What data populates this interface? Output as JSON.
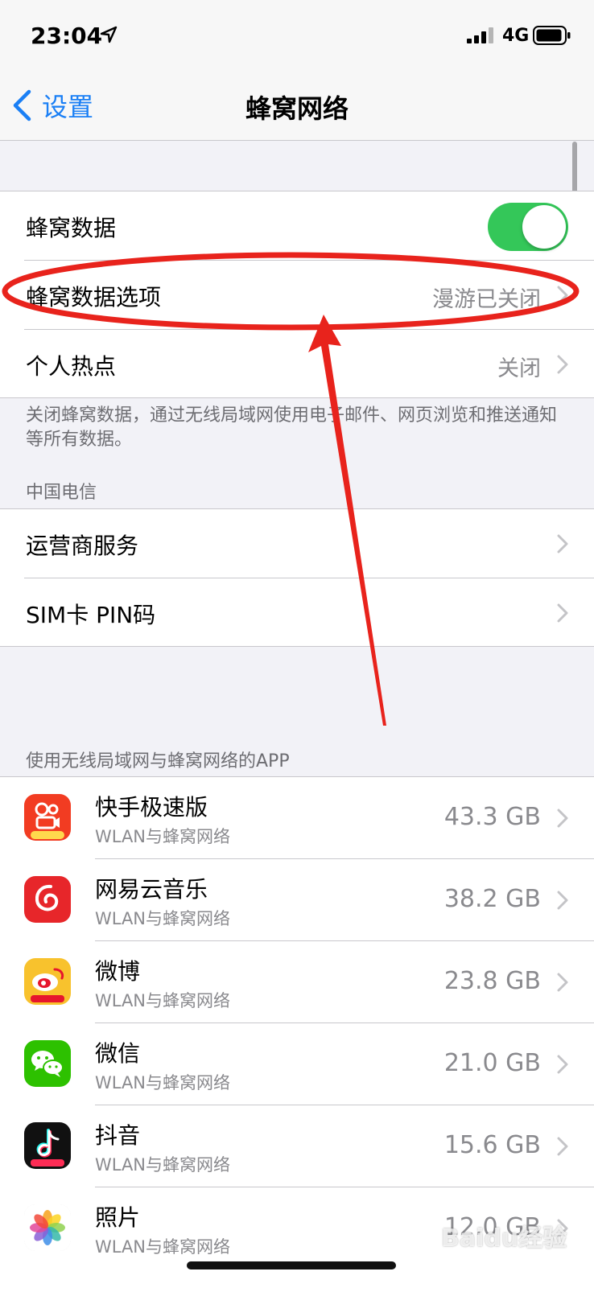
{
  "status_bar": {
    "time": "23:04",
    "network": "4G"
  },
  "nav": {
    "back_label": "设置",
    "title": "蜂窝网络"
  },
  "group1": {
    "cellular_data": {
      "label": "蜂窝数据",
      "enabled": true
    },
    "cellular_options": {
      "label": "蜂窝数据选项",
      "value": "漫游已关闭"
    },
    "hotspot": {
      "label": "个人热点",
      "value": "关闭"
    }
  },
  "footer_note": "关闭蜂窝数据，通过无线局域网使用电子邮件、网页浏览和推送通知等所有数据。",
  "carrier": {
    "header": "中国电信",
    "items": [
      {
        "label": "运营商服务"
      },
      {
        "label": "SIM卡 PIN码"
      }
    ]
  },
  "apps": {
    "header": "使用无线局域网与蜂窝网络的APP",
    "items": [
      {
        "name": "快手极速版",
        "subtitle": "WLAN与蜂窝网络",
        "usage": "43.3 GB"
      },
      {
        "name": "网易云音乐",
        "subtitle": "WLAN与蜂窝网络",
        "usage": "38.2 GB"
      },
      {
        "name": "微博",
        "subtitle": "WLAN与蜂窝网络",
        "usage": "23.8 GB"
      },
      {
        "name": "微信",
        "subtitle": "WLAN与蜂窝网络",
        "usage": "21.0 GB"
      },
      {
        "name": "抖音",
        "subtitle": "WLAN与蜂窝网络",
        "usage": "15.6 GB"
      },
      {
        "name": "照片",
        "subtitle": "WLAN与蜂窝网络",
        "usage": "12.0 GB"
      }
    ]
  },
  "watermark": "Baidu经验",
  "colors": {
    "accent": "#1a7ff5",
    "toggle_on": "#34c759",
    "annotation": "#e8231c"
  }
}
